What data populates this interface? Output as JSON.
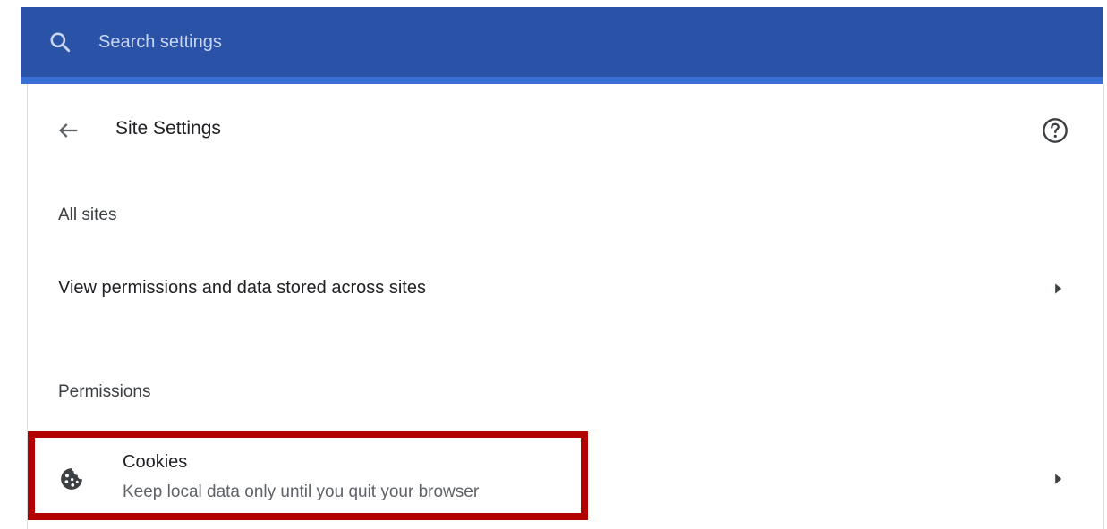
{
  "colors": {
    "search_bar_bg": "#2a53a8",
    "accent_strip": "#3a6fd8",
    "highlight_border": "#b30000"
  },
  "search": {
    "placeholder": "Search settings",
    "icon": "search-icon"
  },
  "header": {
    "back_icon": "arrow-left-icon",
    "title": "Site Settings",
    "help_icon": "help-circle-icon"
  },
  "sections": {
    "all_sites_heading": "All sites",
    "permissions_heading": "Permissions"
  },
  "rows": {
    "view_permissions": {
      "label": "View permissions and data stored across sites",
      "icon": "chevron-right-icon"
    },
    "cookies": {
      "title": "Cookies",
      "subtitle": "Keep local data only until you quit your browser",
      "icon": "cookie-icon",
      "chevron_icon": "chevron-right-icon"
    }
  },
  "annotation": {
    "highlight": "cookies-row"
  }
}
